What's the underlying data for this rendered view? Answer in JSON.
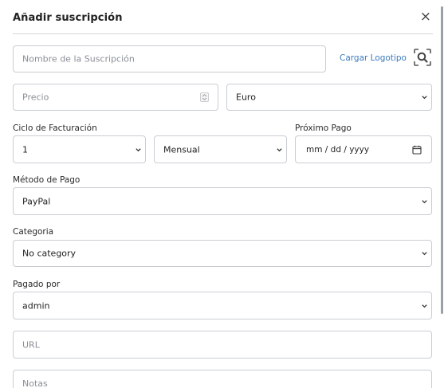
{
  "modal": {
    "title": "Añadir suscripción",
    "close_symbol": "×"
  },
  "form": {
    "name_placeholder": "Nombre de la Suscripción",
    "upload_logo_label": "Cargar Logotipo",
    "search_logo_icon": "search-image-icon",
    "price_placeholder": "Precio",
    "currency_value": "Euro",
    "billing_cycle_label": "Ciclo de Facturación",
    "billing_cycle_number": "1",
    "billing_cycle_period": "Mensual",
    "next_payment_label": "Próximo Pago",
    "next_payment_value": "mm / dd / yyyy",
    "payment_method_label": "Método de Pago",
    "payment_method_value": "PayPal",
    "category_label": "Categoria",
    "category_value": "No category",
    "paid_by_label": "Pagado por",
    "paid_by_value": "admin",
    "url_placeholder": "URL",
    "notes_placeholder": "Notas"
  },
  "colors": {
    "accent_link": "#3b7bbf",
    "border": "#c9cdd2",
    "placeholder": "#8a8f96"
  }
}
